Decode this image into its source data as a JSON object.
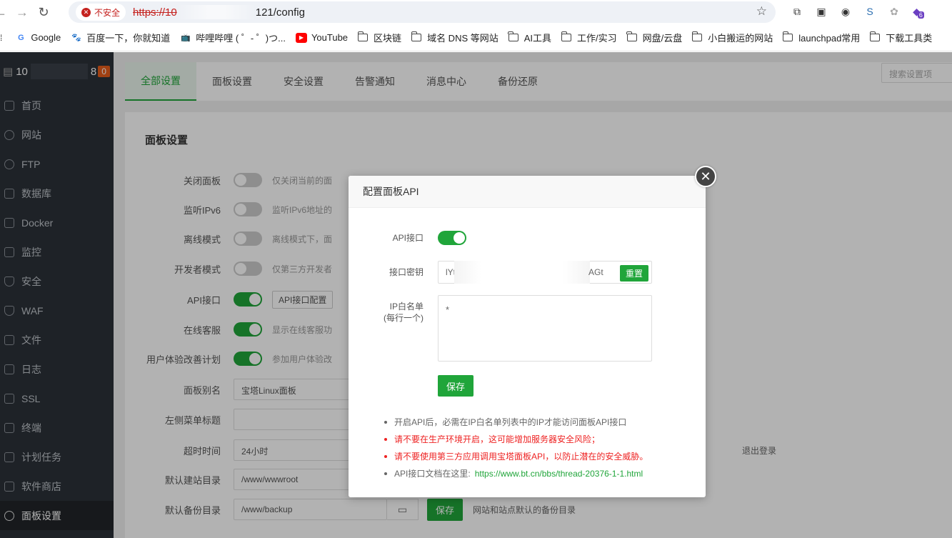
{
  "browser": {
    "insecure_label": "不安全",
    "url_scheme": "https://10",
    "url_tail": "121/config",
    "bookmarks": [
      {
        "label": "Google",
        "icon": "google-icon"
      },
      {
        "label": "百度一下，你就知道",
        "icon": "baidu-icon"
      },
      {
        "label": "哔哩哔哩 ( ゜- ゜)つ...",
        "icon": "bilibili-icon"
      },
      {
        "label": "YouTube",
        "icon": "youtube-icon"
      },
      {
        "label": "区块链",
        "icon": "folder-icon"
      },
      {
        "label": "域名 DNS 等网站",
        "icon": "folder-icon"
      },
      {
        "label": "AI工具",
        "icon": "folder-icon"
      },
      {
        "label": "工作/实习",
        "icon": "folder-icon"
      },
      {
        "label": "网盘/云盘",
        "icon": "folder-icon"
      },
      {
        "label": "小白搬运的网站",
        "icon": "folder-icon"
      },
      {
        "label": "launchpad常用",
        "icon": "folder-icon"
      },
      {
        "label": "下载工具类",
        "icon": "folder-icon"
      }
    ],
    "ext_badge": "6"
  },
  "sidebar": {
    "server_prefix": "10",
    "server_suffix": "8",
    "alert_count": "0",
    "items": [
      {
        "label": "首页",
        "icon": "home-icon"
      },
      {
        "label": "网站",
        "icon": "globe-icon"
      },
      {
        "label": "FTP",
        "icon": "ftp-icon"
      },
      {
        "label": "数据库",
        "icon": "database-icon"
      },
      {
        "label": "Docker",
        "icon": "docker-icon"
      },
      {
        "label": "监控",
        "icon": "monitor-icon"
      },
      {
        "label": "安全",
        "icon": "shield-icon"
      },
      {
        "label": "WAF",
        "icon": "waf-icon"
      },
      {
        "label": "文件",
        "icon": "folder-icon"
      },
      {
        "label": "日志",
        "icon": "log-icon"
      },
      {
        "label": "SSL",
        "icon": "ssl-icon"
      },
      {
        "label": "终端",
        "icon": "terminal-icon"
      },
      {
        "label": "计划任务",
        "icon": "cron-icon"
      },
      {
        "label": "软件商店",
        "icon": "store-icon"
      },
      {
        "label": "面板设置",
        "icon": "gear-icon"
      }
    ]
  },
  "tabs": [
    "全部设置",
    "面板设置",
    "安全设置",
    "告警通知",
    "消息中心",
    "备份还原"
  ],
  "search_placeholder": "搜索设置项",
  "panel": {
    "title": "面板设置",
    "rows": {
      "close_panel": {
        "label": "关闭面板",
        "desc": "仅关闭当前的面"
      },
      "ipv6": {
        "label": "监听IPv6",
        "desc": "监听IPv6地址的"
      },
      "offline": {
        "label": "离线模式",
        "desc": "离线模式下，面"
      },
      "dev": {
        "label": "开发者模式",
        "desc": "仅第三方开发者"
      },
      "api": {
        "label": "API接口",
        "btn": "API接口配置"
      },
      "online_service": {
        "label": "在线客服",
        "desc": "显示在线客服功"
      },
      "ux": {
        "label": "用户体验改善计划",
        "desc": "参加用户体验改"
      },
      "alias": {
        "label": "面板别名",
        "value": "宝塔Linux面板"
      },
      "menu_title": {
        "label": "左侧菜单标题",
        "value": ""
      },
      "timeout": {
        "label": "超时时间",
        "value": "24小时",
        "note": "退出登录"
      },
      "site_dir": {
        "label": "默认建站目录",
        "value": "/www/wwwroot"
      },
      "backup_dir": {
        "label": "默认备份目录",
        "value": "/www/backup",
        "save": "保存",
        "note": "网站和站点默认的备份目录"
      }
    }
  },
  "modal": {
    "title": "配置面板API",
    "api_label": "API接口",
    "key_label": "接口密钥",
    "key_start": "lYt",
    "key_end": "AGt",
    "reset": "重置",
    "ip_label_1": "IP白名单",
    "ip_label_2": "(每行一个)",
    "ip_value": "*",
    "save": "保存",
    "notes": [
      {
        "text": "开启API后，必需在IP白名单列表中的IP才能访问面板API接口",
        "red": false
      },
      {
        "text": "请不要在生产环境开启，这可能增加服务器安全风险；",
        "red": true
      },
      {
        "text": "请不要使用第三方应用调用宝塔面板API，以防止潜在的安全威胁。",
        "red": true
      }
    ],
    "doc_text": "API接口文档在这里:",
    "doc_link": "https://www.bt.cn/bbs/thread-20376-1-1.html"
  },
  "colors": {
    "accent": "#20a53a",
    "danger": "#e22222",
    "sidebar": "#2c3138"
  }
}
